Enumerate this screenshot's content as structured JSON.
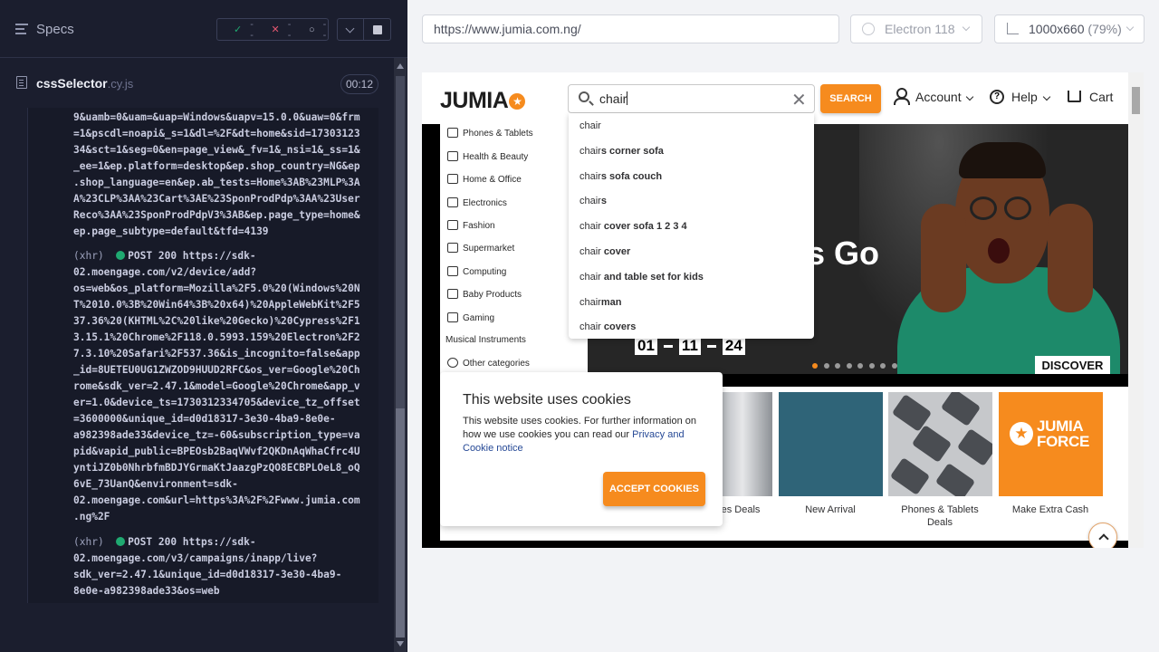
{
  "runner": {
    "specs_label": "Specs",
    "stats": {
      "passed": "--",
      "failed": "--",
      "pending": "--"
    },
    "spec": {
      "name": "cssSelector",
      "ext": ".cy.js",
      "time": "00:12"
    },
    "log": {
      "block1": "9&uamb=0&uam=&uap=Windows&uapv=15.0.0&uaw=0&frm\n=1&pscdl=noapi&_s=1&dl=%2F&dt=home&sid=17303123\n34&sct=1&seg=0&en=page_view&_fv=1&_nsi=1&_ss=1&\n_ee=1&ep.platform=desktop&ep.shop_country=NG&ep\n.shop_language=en&ep.ab_tests=Home%3AB%23MLP%3A\nA%23CLP%3AA%23Cart%3AE%23SponProdPdp%3AA%23User\nReco%3AA%23SponProdPdpV3%3AB&ep.page_type=home&\nep.page_subtype=default&tfd=4139",
      "entry2_prefix": "(xhr)",
      "entry2_first": "POST 200 https://sdk-",
      "block2": "02.moengage.com/v2/device/add?\nos=web&os_platform=Mozilla%2F5.0%20(Windows%20N\nT%2010.0%3B%20Win64%3B%20x64)%20AppleWebKit%2F5\n37.36%20(KHTML%2C%20like%20Gecko)%20Cypress%2F1\n3.15.1%20Chrome%2F118.0.5993.159%20Electron%2F2\n7.3.10%20Safari%2F537.36&is_incognito=false&app\n_id=8UETEU0UG1ZWZOD9HUUD2RFC&os_ver=Google%20Ch\nrome&sdk_ver=2.47.1&model=Google%20Chrome&app_v\ner=1.0&device_ts=1730312334705&device_tz_offset\n=3600000&unique_id=d0d18317-3e30-4ba9-8e0e-\na982398ade33&device_tz=-60&subscription_type=va\npid&vapid_public=BPEOsb2BaqVWvf2QKDnAqWhaCfrc4U\nyntiJZ0b0NhrbfmBDJYGrmaKtJaazgPzQO8ECBPLOeL8_oQ\n6vE_73UanQ&environment=sdk-\n02.moengage.com&url=https%3A%2F%2Fwww.jumia.com\n.ng%2F",
      "entry3_prefix": "(xhr)",
      "entry3_first": "POST 200 https://sdk-",
      "block3": "02.moengage.com/v3/campaigns/inapp/live?\nsdk_ver=2.47.1&unique_id=d0d18317-3e30-4ba9-\n8e0e-a982398ade33&os=web"
    }
  },
  "browser": {
    "url": "https://www.jumia.com.ng/",
    "engine": "Electron 118",
    "viewport": "1000x660",
    "viewport_pct": "(79%)"
  },
  "site": {
    "logo": "JUMIA",
    "search_value": "chair",
    "search_button": "SEARCH",
    "account": "Account",
    "help": "Help",
    "cart": "Cart",
    "categories": [
      "Phones & Tablets",
      "Health & Beauty",
      "Home & Office",
      "Electronics",
      "Fashion",
      "Supermarket",
      "Computing",
      "Baby Products",
      "Gaming",
      "Musical Instruments",
      "Other categories"
    ],
    "suggestions": [
      {
        "prefix": "chair",
        "rest": ""
      },
      {
        "prefix": "chair",
        "rest": "s corner sofa"
      },
      {
        "prefix": "chair",
        "rest": "s sofa couch"
      },
      {
        "prefix": "chair",
        "rest": "s"
      },
      {
        "prefix": "chair",
        "rest": " cover sofa 1 2 3 4"
      },
      {
        "prefix": "chair",
        "rest": " cover"
      },
      {
        "prefix": "chair",
        "rest": " and table set for kids"
      },
      {
        "prefix": "chair",
        "rest": "man"
      },
      {
        "prefix": "chair",
        "rest": " covers"
      }
    ],
    "banner": {
      "title_fragment": "s Go",
      "countdown": [
        "01",
        "11",
        "24"
      ],
      "discover": "DISCOVER",
      "dots_total": 8,
      "active_dot": 1
    },
    "tiles": [
      {
        "label": "es Deals"
      },
      {
        "label": "New Arrival"
      },
      {
        "label": "Phones & Tablets\nDeals"
      },
      {
        "label": "Make Extra Cash"
      }
    ],
    "force_logo": "JUMIA\nFORCE",
    "cookie": {
      "title": "This website uses cookies",
      "body": "This website uses cookies. For further information on how we use cookies you can read our ",
      "link": "Privacy and Cookie notice",
      "accept": "ACCEPT COOKIES"
    }
  },
  "colors": {
    "brand": "#f68b1e",
    "pass": "#1fa971",
    "fail": "#e45770",
    "panel": "#1b1e2e"
  }
}
